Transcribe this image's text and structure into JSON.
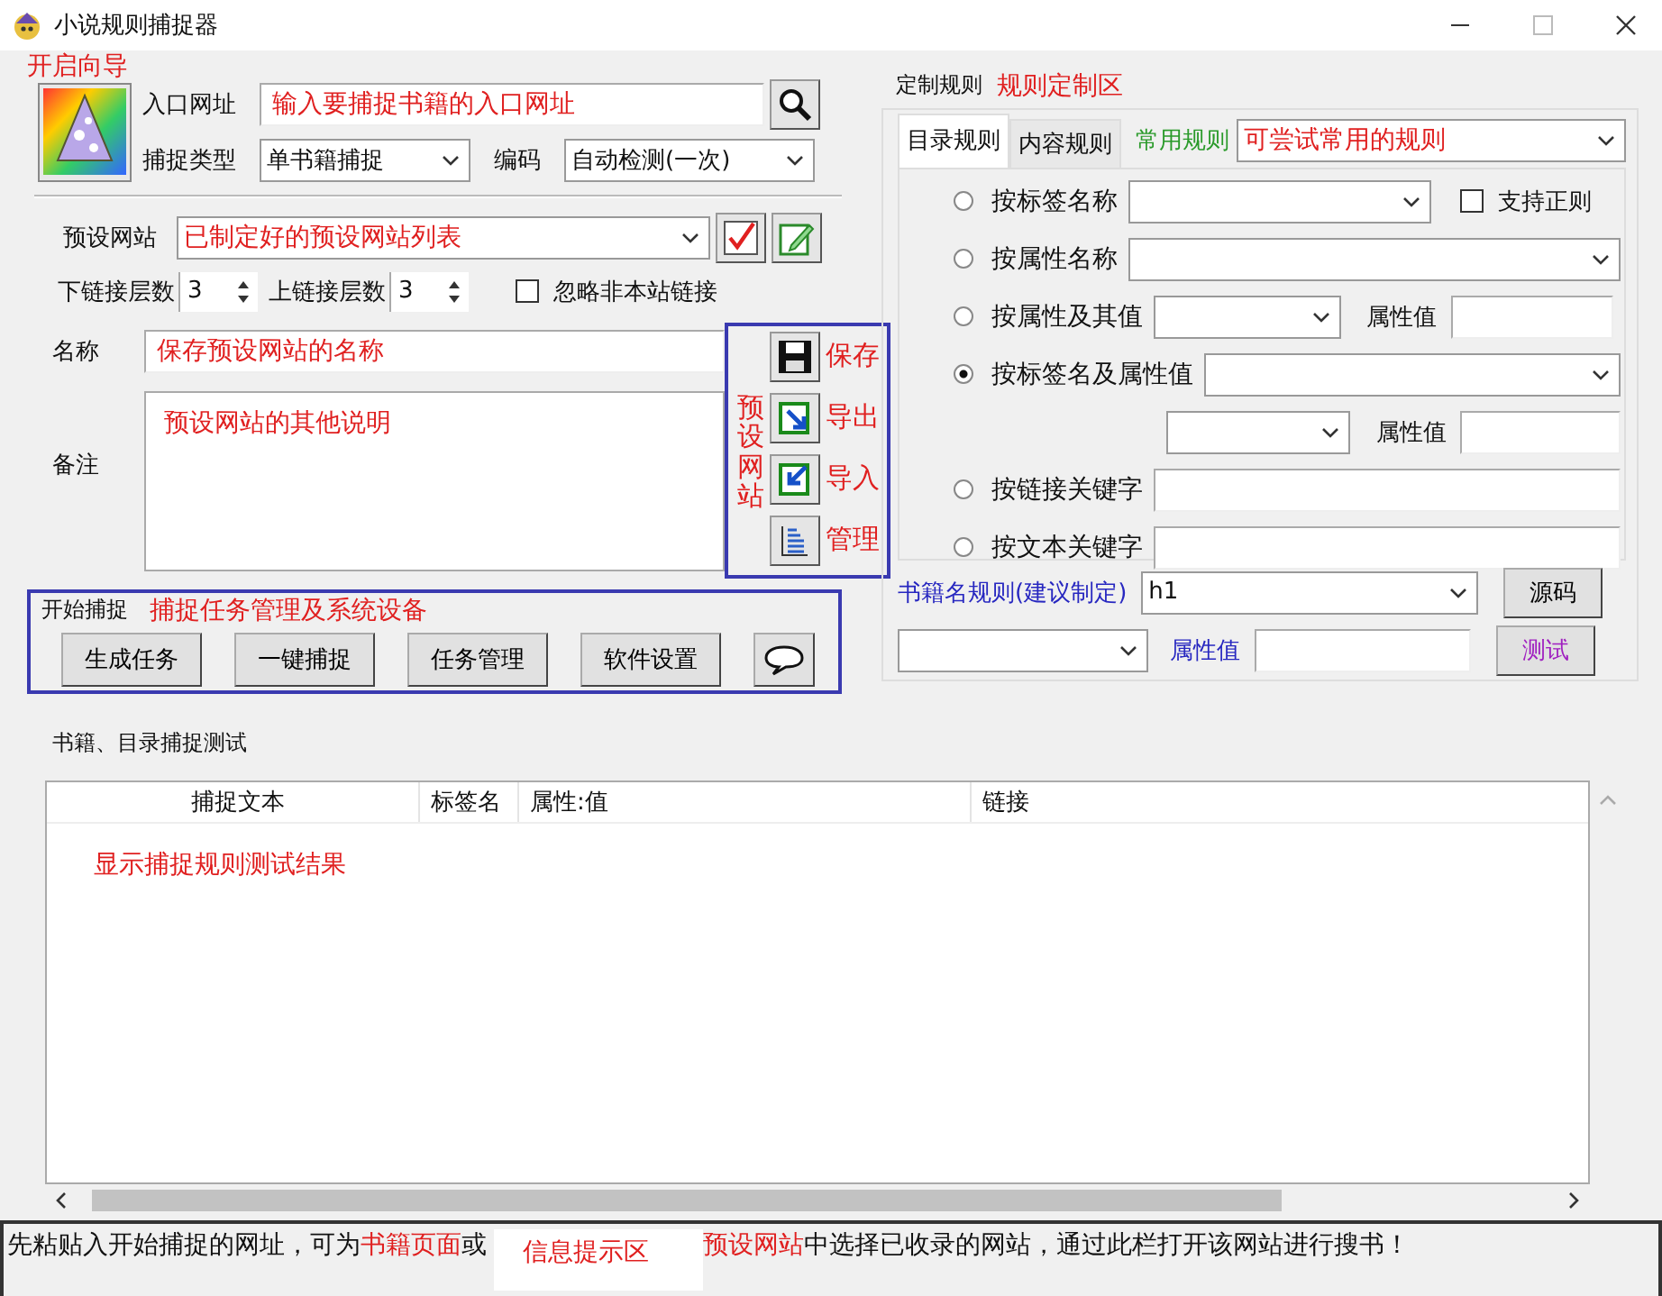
{
  "window": {
    "title": "小说规则捕捉器"
  },
  "wizard": {
    "annotation": "开启向导"
  },
  "entry": {
    "label": "入口网址",
    "value": "输入要捕捉书籍的入口网址"
  },
  "capture_type": {
    "label": "捕捉类型",
    "value": "单书籍捕捉"
  },
  "encoding": {
    "label": "编码",
    "value": "自动检测(一次)"
  },
  "preset": {
    "label": "预设网站",
    "value": "已制定好的预设网站列表"
  },
  "depth": [
    {
      "label": "下链接层数",
      "value": "3"
    },
    {
      "label": "上链接层数",
      "value": "3"
    }
  ],
  "ignore_external": {
    "label": "忽略非本站链接",
    "checked": false
  },
  "name": {
    "label": "名称",
    "value": "保存预设网站的名称"
  },
  "note": {
    "label": "备注",
    "value": "预设网站的其他说明"
  },
  "preset_tools": {
    "annotation": "预设网站",
    "buttons": [
      {
        "kind": "save",
        "annotation": "保存"
      },
      {
        "kind": "export",
        "annotation": "导出"
      },
      {
        "kind": "import",
        "annotation": "导入"
      },
      {
        "kind": "manage",
        "annotation": "管理"
      }
    ]
  },
  "capture_group": {
    "title": "开始捕捉",
    "annotation": "捕捉任务管理及系统设备",
    "buttons": [
      {
        "kind": "text",
        "label": "生成任务"
      },
      {
        "kind": "text",
        "label": "一键捕捉"
      },
      {
        "kind": "text",
        "label": "任务管理"
      },
      {
        "kind": "text",
        "label": "软件设置"
      },
      {
        "kind": "chat"
      }
    ]
  },
  "rules": {
    "title": "定制规则",
    "annotation": "规则定制区",
    "tabs": [
      {
        "label": "目录规则",
        "selected": true
      },
      {
        "label": "内容规则",
        "selected": false
      }
    ],
    "common": {
      "label": "常用规则",
      "value": "可尝试常用的规则"
    },
    "regex": {
      "label": "支持正则",
      "checked": false
    },
    "options": [
      {
        "kind": "tag_combo",
        "label": "按标签名称",
        "selected": false
      },
      {
        "kind": "combo",
        "label": "按属性名称",
        "selected": false
      },
      {
        "kind": "combo_attr",
        "label": "按属性及其值",
        "selected": false,
        "attr_label": "属性值"
      },
      {
        "kind": "combo",
        "label": "按标签名及属性值",
        "selected": true,
        "second_attr_label": "属性值"
      },
      {
        "kind": "input",
        "label": "按链接关键字",
        "selected": false
      },
      {
        "kind": "input",
        "label": "按文本关键字",
        "selected": false
      }
    ],
    "book_name": {
      "label": "书籍名规则(建议制定)",
      "value": "h1"
    },
    "source_button": "源码",
    "attr_label": "属性值",
    "test_button": "测试"
  },
  "test": {
    "title": "书籍、目录捕捉测试",
    "columns": [
      "捕捉文本",
      "标签名",
      "属性:值",
      "链接"
    ],
    "annotation": "显示捕捉规则测试结果"
  },
  "status_bar": {
    "before": [
      {
        "text": "先粘贴入开始捕捉的网址，可为",
        "highlight": false
      },
      {
        "text": "书籍页面",
        "highlight": true
      },
      {
        "text": "或",
        "highlight": false
      }
    ],
    "after": [
      {
        "text": "预设网站",
        "highlight": true
      },
      {
        "text": "中选择已收录的网站，通过此栏打开该网站进行搜书！",
        "highlight": false
      }
    ],
    "annotation": "信息提示区"
  }
}
